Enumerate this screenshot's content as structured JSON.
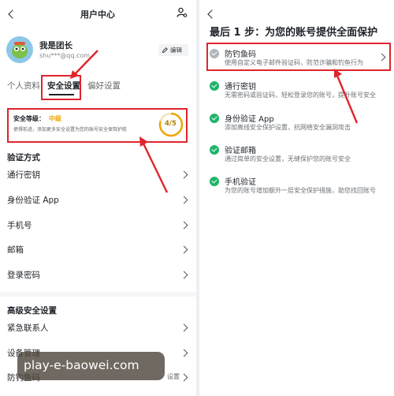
{
  "left": {
    "header": {
      "title": "用户中心",
      "user_icon": "user-settings-icon"
    },
    "profile": {
      "name": "我是团长",
      "email": "shu***@qq.com",
      "edit_label": "编辑"
    },
    "tabs": [
      {
        "label": "个人资料",
        "active": false
      },
      {
        "label": "安全设置",
        "active": true
      },
      {
        "label": "偏好设置",
        "active": false
      }
    ],
    "security_card": {
      "level_label": "安全等级：",
      "level_value": "中级",
      "description": "使得前进，添加更多安全设置为您的账号安全保驾护航",
      "score": "4/5",
      "score_fraction": 0.8
    },
    "verify_section": {
      "title": "验证方式",
      "items": [
        "通行密钥",
        "身份验证 App",
        "手机号",
        "邮箱",
        "登录密码"
      ]
    },
    "advanced_section": {
      "title": "高级安全设置",
      "items": [
        "紧急联系人",
        "设备管理",
        "防钓鱼码"
      ]
    },
    "partial_text": "设置",
    "watermark": "play-e-baowei.com"
  },
  "right": {
    "title": "最后 1 步：为您的账号提供全面保护",
    "items": [
      {
        "title": "防钓鱼码",
        "desc": "使用自定义电子邮件验证码，防范诈骗和钓鱼行为",
        "done": false,
        "chevron": true
      },
      {
        "title": "通行密钥",
        "desc": "无需密码或验证码，轻松登录您的账号，提升账号安全",
        "done": true,
        "chevron": false
      },
      {
        "title": "身份验证 App",
        "desc": "添加离线安全保护设置，抗网络安全漏洞攻击",
        "done": true,
        "chevron": false
      },
      {
        "title": "验证邮箱",
        "desc": "通过简单的安全设置，无缝保护您的账号安全",
        "done": true,
        "chevron": false
      },
      {
        "title": "手机验证",
        "desc": "为您的账号增加额外一层安全保护措施，助您找回账号",
        "done": true,
        "chevron": false
      }
    ]
  },
  "colors": {
    "annotation_red": "#e0242c",
    "accent_orange": "#f0a500",
    "check_green": "#20b46a",
    "text_dark": "#1f2329",
    "watermark_bg": "#5a5147"
  }
}
